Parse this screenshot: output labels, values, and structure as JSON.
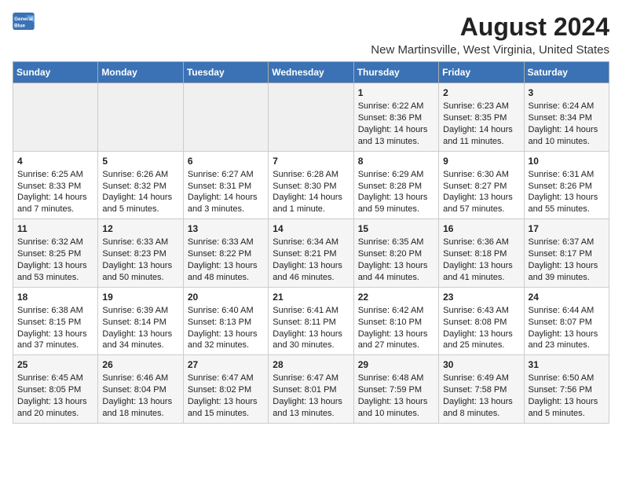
{
  "logo": {
    "line1": "General",
    "line2": "Blue"
  },
  "title": "August 2024",
  "subtitle": "New Martinsville, West Virginia, United States",
  "days_of_week": [
    "Sunday",
    "Monday",
    "Tuesday",
    "Wednesday",
    "Thursday",
    "Friday",
    "Saturday"
  ],
  "weeks": [
    [
      {
        "day": "",
        "empty": true
      },
      {
        "day": "",
        "empty": true
      },
      {
        "day": "",
        "empty": true
      },
      {
        "day": "",
        "empty": true
      },
      {
        "day": "1",
        "line1": "Sunrise: 6:22 AM",
        "line2": "Sunset: 8:36 PM",
        "line3": "Daylight: 14 hours",
        "line4": "and 13 minutes."
      },
      {
        "day": "2",
        "line1": "Sunrise: 6:23 AM",
        "line2": "Sunset: 8:35 PM",
        "line3": "Daylight: 14 hours",
        "line4": "and 11 minutes."
      },
      {
        "day": "3",
        "line1": "Sunrise: 6:24 AM",
        "line2": "Sunset: 8:34 PM",
        "line3": "Daylight: 14 hours",
        "line4": "and 10 minutes."
      }
    ],
    [
      {
        "day": "4",
        "line1": "Sunrise: 6:25 AM",
        "line2": "Sunset: 8:33 PM",
        "line3": "Daylight: 14 hours",
        "line4": "and 7 minutes."
      },
      {
        "day": "5",
        "line1": "Sunrise: 6:26 AM",
        "line2": "Sunset: 8:32 PM",
        "line3": "Daylight: 14 hours",
        "line4": "and 5 minutes."
      },
      {
        "day": "6",
        "line1": "Sunrise: 6:27 AM",
        "line2": "Sunset: 8:31 PM",
        "line3": "Daylight: 14 hours",
        "line4": "and 3 minutes."
      },
      {
        "day": "7",
        "line1": "Sunrise: 6:28 AM",
        "line2": "Sunset: 8:30 PM",
        "line3": "Daylight: 14 hours",
        "line4": "and 1 minute."
      },
      {
        "day": "8",
        "line1": "Sunrise: 6:29 AM",
        "line2": "Sunset: 8:28 PM",
        "line3": "Daylight: 13 hours",
        "line4": "and 59 minutes."
      },
      {
        "day": "9",
        "line1": "Sunrise: 6:30 AM",
        "line2": "Sunset: 8:27 PM",
        "line3": "Daylight: 13 hours",
        "line4": "and 57 minutes."
      },
      {
        "day": "10",
        "line1": "Sunrise: 6:31 AM",
        "line2": "Sunset: 8:26 PM",
        "line3": "Daylight: 13 hours",
        "line4": "and 55 minutes."
      }
    ],
    [
      {
        "day": "11",
        "line1": "Sunrise: 6:32 AM",
        "line2": "Sunset: 8:25 PM",
        "line3": "Daylight: 13 hours",
        "line4": "and 53 minutes."
      },
      {
        "day": "12",
        "line1": "Sunrise: 6:33 AM",
        "line2": "Sunset: 8:23 PM",
        "line3": "Daylight: 13 hours",
        "line4": "and 50 minutes."
      },
      {
        "day": "13",
        "line1": "Sunrise: 6:33 AM",
        "line2": "Sunset: 8:22 PM",
        "line3": "Daylight: 13 hours",
        "line4": "and 48 minutes."
      },
      {
        "day": "14",
        "line1": "Sunrise: 6:34 AM",
        "line2": "Sunset: 8:21 PM",
        "line3": "Daylight: 13 hours",
        "line4": "and 46 minutes."
      },
      {
        "day": "15",
        "line1": "Sunrise: 6:35 AM",
        "line2": "Sunset: 8:20 PM",
        "line3": "Daylight: 13 hours",
        "line4": "and 44 minutes."
      },
      {
        "day": "16",
        "line1": "Sunrise: 6:36 AM",
        "line2": "Sunset: 8:18 PM",
        "line3": "Daylight: 13 hours",
        "line4": "and 41 minutes."
      },
      {
        "day": "17",
        "line1": "Sunrise: 6:37 AM",
        "line2": "Sunset: 8:17 PM",
        "line3": "Daylight: 13 hours",
        "line4": "and 39 minutes."
      }
    ],
    [
      {
        "day": "18",
        "line1": "Sunrise: 6:38 AM",
        "line2": "Sunset: 8:15 PM",
        "line3": "Daylight: 13 hours",
        "line4": "and 37 minutes."
      },
      {
        "day": "19",
        "line1": "Sunrise: 6:39 AM",
        "line2": "Sunset: 8:14 PM",
        "line3": "Daylight: 13 hours",
        "line4": "and 34 minutes."
      },
      {
        "day": "20",
        "line1": "Sunrise: 6:40 AM",
        "line2": "Sunset: 8:13 PM",
        "line3": "Daylight: 13 hours",
        "line4": "and 32 minutes."
      },
      {
        "day": "21",
        "line1": "Sunrise: 6:41 AM",
        "line2": "Sunset: 8:11 PM",
        "line3": "Daylight: 13 hours",
        "line4": "and 30 minutes."
      },
      {
        "day": "22",
        "line1": "Sunrise: 6:42 AM",
        "line2": "Sunset: 8:10 PM",
        "line3": "Daylight: 13 hours",
        "line4": "and 27 minutes."
      },
      {
        "day": "23",
        "line1": "Sunrise: 6:43 AM",
        "line2": "Sunset: 8:08 PM",
        "line3": "Daylight: 13 hours",
        "line4": "and 25 minutes."
      },
      {
        "day": "24",
        "line1": "Sunrise: 6:44 AM",
        "line2": "Sunset: 8:07 PM",
        "line3": "Daylight: 13 hours",
        "line4": "and 23 minutes."
      }
    ],
    [
      {
        "day": "25",
        "line1": "Sunrise: 6:45 AM",
        "line2": "Sunset: 8:05 PM",
        "line3": "Daylight: 13 hours",
        "line4": "and 20 minutes."
      },
      {
        "day": "26",
        "line1": "Sunrise: 6:46 AM",
        "line2": "Sunset: 8:04 PM",
        "line3": "Daylight: 13 hours",
        "line4": "and 18 minutes."
      },
      {
        "day": "27",
        "line1": "Sunrise: 6:47 AM",
        "line2": "Sunset: 8:02 PM",
        "line3": "Daylight: 13 hours",
        "line4": "and 15 minutes."
      },
      {
        "day": "28",
        "line1": "Sunrise: 6:47 AM",
        "line2": "Sunset: 8:01 PM",
        "line3": "Daylight: 13 hours",
        "line4": "and 13 minutes."
      },
      {
        "day": "29",
        "line1": "Sunrise: 6:48 AM",
        "line2": "Sunset: 7:59 PM",
        "line3": "Daylight: 13 hours",
        "line4": "and 10 minutes."
      },
      {
        "day": "30",
        "line1": "Sunrise: 6:49 AM",
        "line2": "Sunset: 7:58 PM",
        "line3": "Daylight: 13 hours",
        "line4": "and 8 minutes."
      },
      {
        "day": "31",
        "line1": "Sunrise: 6:50 AM",
        "line2": "Sunset: 7:56 PM",
        "line3": "Daylight: 13 hours",
        "line4": "and 5 minutes."
      }
    ]
  ]
}
